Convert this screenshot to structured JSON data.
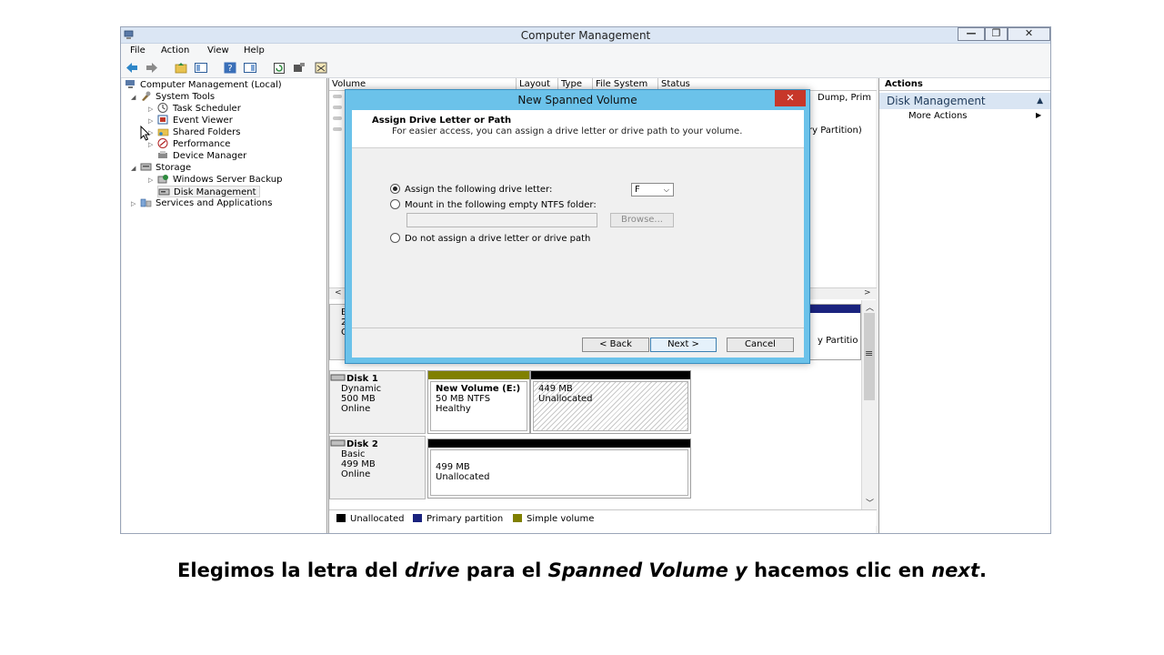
{
  "window": {
    "title": "Computer Management",
    "controls": {
      "minimize": "—",
      "restore": "❐",
      "close": "✕"
    }
  },
  "menu": [
    "File",
    "Action",
    "View",
    "Help"
  ],
  "toolbar_icons": [
    "back-icon",
    "forward-icon",
    "folder-up-icon",
    "console-tree-icon",
    "help-icon",
    "properties-icon",
    "refresh-icon",
    "settings-icon",
    "export-icon"
  ],
  "tree": {
    "root": "Computer Management (Local)",
    "system_tools": "System Tools",
    "task_scheduler": "Task Scheduler",
    "event_viewer": "Event Viewer",
    "shared_folders": "Shared Folders",
    "performance": "Performance",
    "device_manager": "Device Manager",
    "storage": "Storage",
    "windows_server_backup": "Windows Server Backup",
    "disk_management": "Disk Management",
    "services_applications": "Services and Applications"
  },
  "volume_list": {
    "columns": [
      "Volume",
      "Layout",
      "Type",
      "File System",
      "Status"
    ],
    "partial_status_1": "Dump, Prim",
    "partial_status_2": "ry Partition)",
    "partial_map_text": "y Partitio"
  },
  "disk_map": {
    "disk0_partial": [
      "B",
      "2",
      "O"
    ],
    "disk1": {
      "name": "Disk 1",
      "type": "Dynamic",
      "size": "500 MB",
      "status": "Online"
    },
    "disk1_part1": {
      "label": "New Volume  (E:)",
      "size": "50 MB NTFS",
      "status": "Healthy"
    },
    "disk1_part2": {
      "size": "449 MB",
      "status": "Unallocated"
    },
    "disk2": {
      "name": "Disk 2",
      "type": "Basic",
      "size": "499 MB",
      "status": "Online"
    },
    "disk2_part1": {
      "size": "499 MB",
      "status": "Unallocated"
    }
  },
  "legend": [
    {
      "label": "Unallocated",
      "color": "#000000"
    },
    {
      "label": "Primary partition",
      "color": "#1a237e"
    },
    {
      "label": "Simple volume",
      "color": "#808000"
    }
  ],
  "actions": {
    "header": "Actions",
    "section": "Disk Management",
    "more": "More Actions"
  },
  "dialog": {
    "title": "New Spanned Volume",
    "close": "✕",
    "heading": "Assign Drive Letter or Path",
    "subheading": "For easier access, you can assign a drive letter or drive path to your volume.",
    "option_letter": "Assign the following drive letter:",
    "drive_letter": "F",
    "option_folder": "Mount in the following empty NTFS folder:",
    "browse": "Browse...",
    "option_none": "Do not assign a drive letter or drive path",
    "back": "< Back",
    "next": "Next >",
    "cancel": "Cancel"
  },
  "caption": {
    "part1": "Elegimos la letra del ",
    "drive": "drive",
    "part2": " para el ",
    "spanned": "Spanned Volume y",
    "part3": " hacemos clic en ",
    "next": "next",
    "part4": "."
  }
}
